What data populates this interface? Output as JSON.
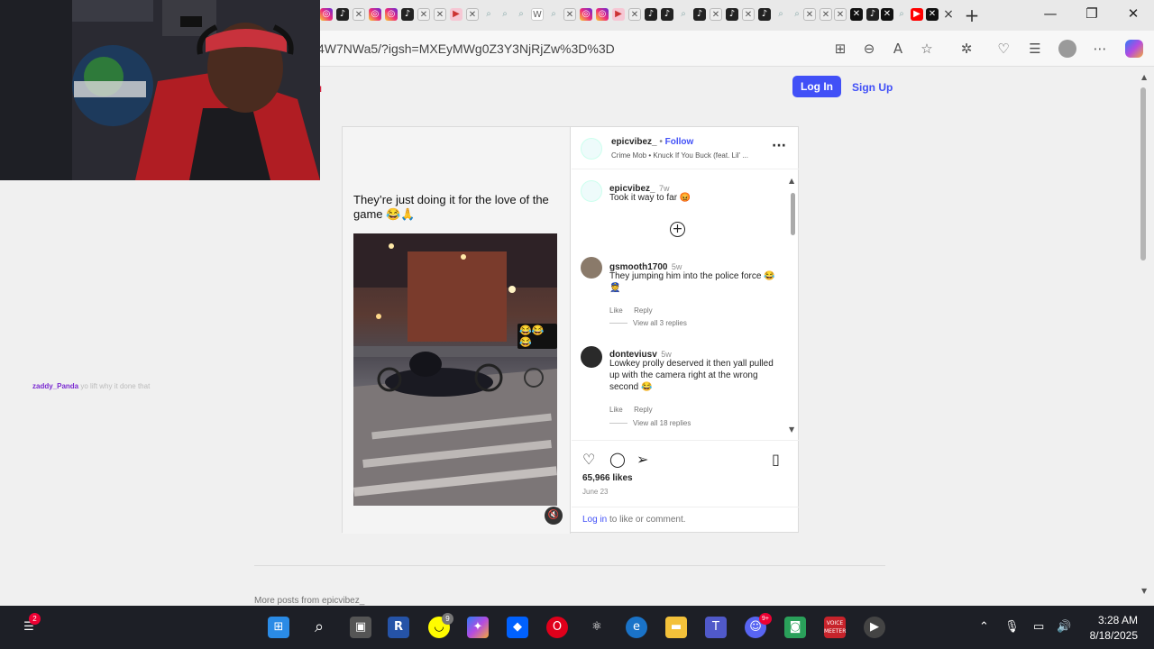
{
  "browser": {
    "address_url": "4W7NWa5/?igsh=MXEyMWg0Z3Y3NjRjZw%3D%3D",
    "new_tab_label": "+",
    "close_tab_label": "×"
  },
  "site_header": {
    "login_label": "Log In",
    "signup_label": "Sign Up"
  },
  "post": {
    "caption": "They’re just doing it for the love of the game 😂🙏",
    "video_overlay_emoji": "😂😂😂",
    "author": "epicvibez_",
    "follow_label": "Follow",
    "music": "Crime Mob • Knuck If You Buck (feat. Lil' ...",
    "more_label": "···",
    "likes": "65,966 likes",
    "date": "June 23",
    "login_link": "Log in",
    "login_suffix": " to like or comment.",
    "comments": [
      {
        "user": "epicvibez_",
        "time": "7w",
        "text": "Took it way to far 😡",
        "like": "",
        "reply": "",
        "replies": ""
      },
      {
        "user": "gsmooth1700",
        "time": "5w",
        "text": "They jumping him into the police force 😂 👮",
        "like": "Like",
        "reply": "Reply",
        "replies": "View all 3 replies"
      },
      {
        "user": "donteviusv",
        "time": "5w",
        "text": "Lowkey prolly deserved it then yall pulled up with the camera right at the wrong second 😂",
        "like": "Like",
        "reply": "Reply",
        "replies": "View all 18 replies"
      }
    ]
  },
  "more_posts_label": "More posts from epicvibez_",
  "chat_overlay": {
    "user": "zaddy_Panda",
    "message": "yo lift why it done that"
  },
  "taskbar": {
    "time": "3:28 AM",
    "date": "8/18/2025",
    "notification_count": "2",
    "snapchat_badge": "9",
    "discord_badge": "9+",
    "voicemeeter_label": "VOICE MEETER"
  },
  "colors": {
    "accent": "#4150f7",
    "taskbar": "#1d1f26"
  }
}
